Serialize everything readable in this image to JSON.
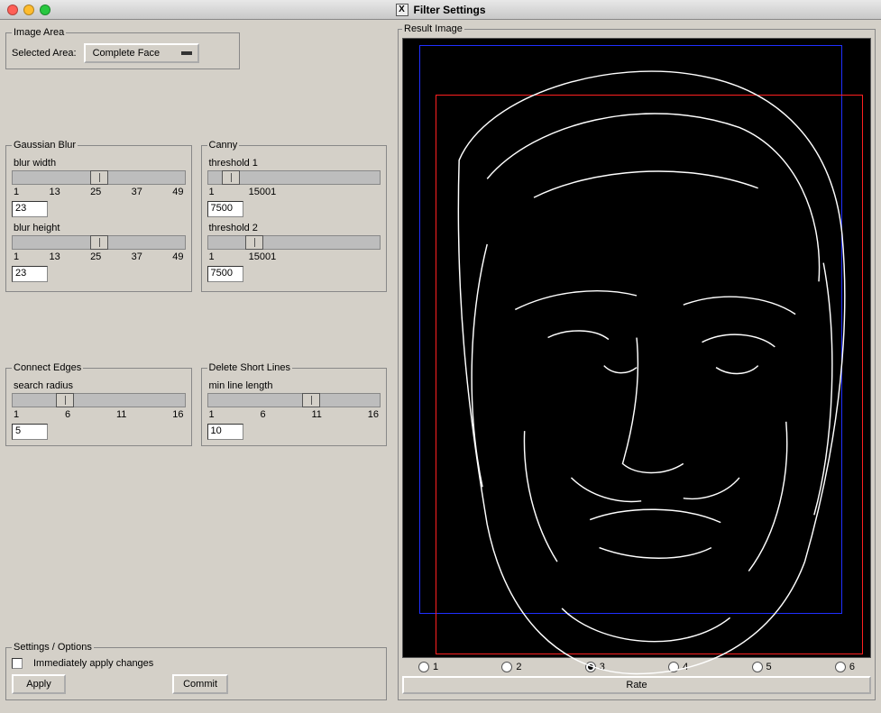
{
  "window": {
    "title": "Filter Settings"
  },
  "imageArea": {
    "legend": "Image Area",
    "label": "Selected Area:",
    "selected": "Complete Face"
  },
  "gaussian": {
    "legend": "Gaussian Blur",
    "blurWidth": {
      "label": "blur width",
      "ticks": [
        "1",
        "13",
        "25",
        "37",
        "49"
      ],
      "value": "23",
      "thumbPct": 45
    },
    "blurHeight": {
      "label": "blur height",
      "ticks": [
        "1",
        "13",
        "25",
        "37",
        "49"
      ],
      "value": "23",
      "thumbPct": 45
    }
  },
  "canny": {
    "legend": "Canny",
    "threshold1": {
      "label": "threshold 1",
      "ticks": [
        "1",
        "15001"
      ],
      "value": "7500",
      "thumbPct": 8
    },
    "threshold2": {
      "label": "threshold 2",
      "ticks": [
        "1",
        "15001"
      ],
      "value": "7500",
      "thumbPct": 22
    }
  },
  "connectEdges": {
    "legend": "Connect Edges",
    "searchRadius": {
      "label": "search radius",
      "ticks": [
        "1",
        "6",
        "11",
        "16"
      ],
      "value": "5",
      "thumbPct": 25
    }
  },
  "deleteShort": {
    "legend": "Delete Short Lines",
    "minLine": {
      "label": "min line length",
      "ticks": [
        "1",
        "6",
        "11",
        "16"
      ],
      "value": "10",
      "thumbPct": 55
    }
  },
  "settings": {
    "legend": "Settings / Options",
    "immediate": "Immediately apply changes",
    "apply": "Apply",
    "commit": "Commit"
  },
  "result": {
    "legend": "Result Image",
    "ratings": [
      "1",
      "2",
      "3",
      "4",
      "5",
      "6"
    ],
    "selected": "3",
    "rateLabel": "Rate"
  }
}
